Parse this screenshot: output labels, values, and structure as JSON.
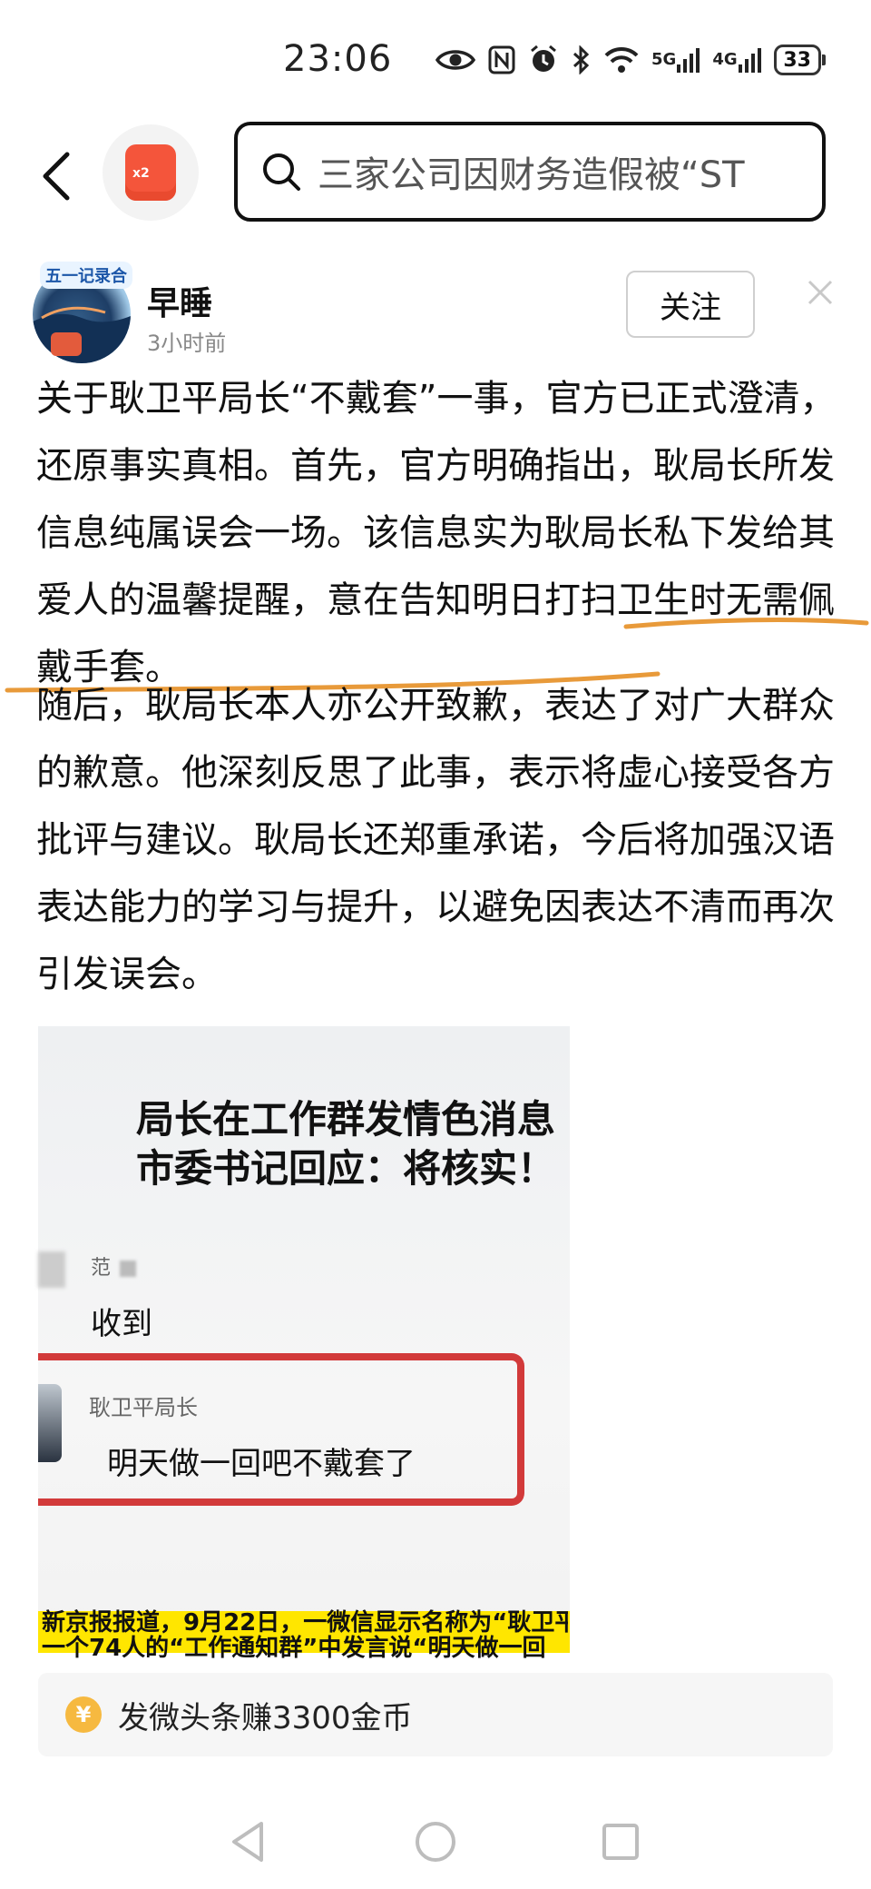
{
  "status_bar": {
    "time": "23:06",
    "network1": "5G",
    "network2": "4G",
    "battery": "33"
  },
  "top_bar": {
    "redpack_label": "x2",
    "search_text": "三家公司因财务造假被“ST"
  },
  "post": {
    "avatar_badge": "五一记录合",
    "author": "早睡",
    "time": "3小时前",
    "follow_label": "关注",
    "paragraph1": "关于耿卫平局长“不戴套”一事，官方已正式澄清，还原事实真相。首先，官方明确指出，耿局长所发信息纯属误会一场。该信息实为耿局长私下发给其爱人的温馨提醒，意在告知明日打扫卫生时无需佩戴手套。",
    "paragraph2": "随后，耿局长本人亦公开致歉，表达了对广大群众的歉意。他深刻反思了此事，表示将虚心接受各方批评与建议。耿局长还郑重承诺，今后将加强汉语表达能力的学习与提升，以避免因表达不清而再次引发误会。"
  },
  "embedded_image": {
    "title_line1": "局长在工作群发情色消息",
    "title_line2": "市委书记回应：将核实！",
    "chat1_name": "范",
    "chat1_msg": "收到",
    "chat2_name": "耿卫平局长",
    "chat2_msg": "明天做一回吧不戴套了",
    "news_line1": "新京报报道，9月22日，一微信显示名称为“耿卫平",
    "news_line2": "一个74人的“工作通知群”中发言说“明天做一回"
  },
  "promo": {
    "coin_symbol": "¥",
    "text": "发微头条赚3300金币"
  },
  "nav": {
    "back_icon": "triangle-back-icon",
    "home_icon": "circle-home-icon",
    "recents_icon": "square-recents-icon"
  }
}
